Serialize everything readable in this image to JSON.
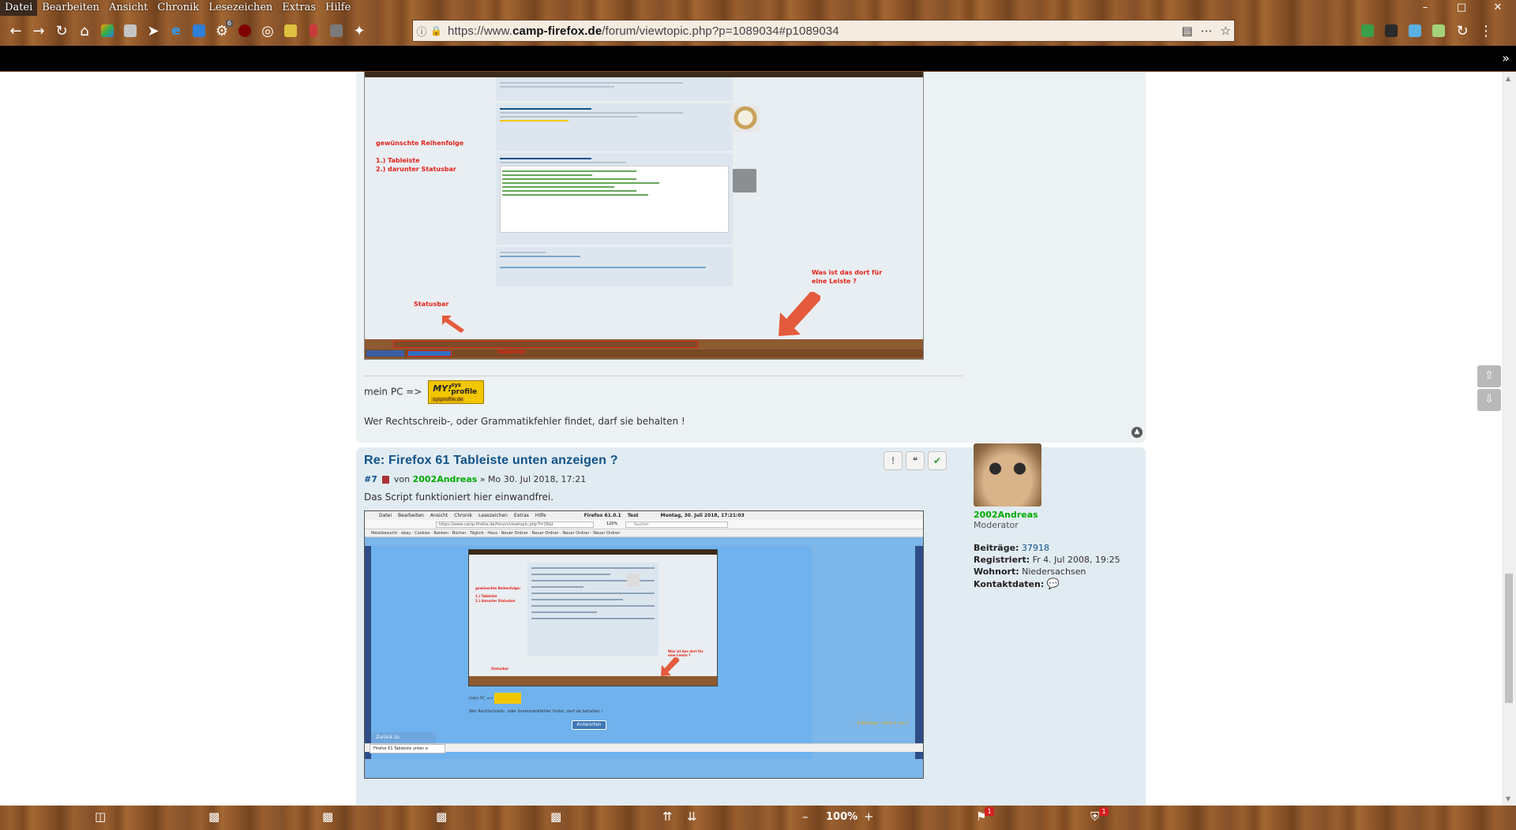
{
  "menubar": {
    "items": [
      "Datei",
      "Bearbeiten",
      "Ansicht",
      "Chronik",
      "Lesezeichen",
      "Extras",
      "Hilfe"
    ],
    "window_controls": [
      "–",
      "□",
      "✕"
    ]
  },
  "navbar": {
    "url_prefix": "https://www.",
    "url_domain": "camp-firefox.de",
    "url_path": "/forum/viewtopic.php?p=1089034#p1089034",
    "ublock_badge": "6"
  },
  "post1": {
    "screenshot_labels": {
      "wish_title": "gewünschte Reihenfolge",
      "wish_line1": "1.) Tableiste",
      "wish_line2": "2.) darunter Statusbar",
      "question": "Was ist das dort für eine Leiste ?",
      "statusbar": "Statusbar",
      "tableiste": "Tableiste"
    },
    "sig_prefix": "mein PC =>",
    "sig_logo_my": "MY!",
    "sig_logo_sys": "sys",
    "sig_logo_profile": "profile",
    "sig_logo_url": "sysprofile.de",
    "sig_line": "Wer Rechtschreib-, oder Grammatikfehler findet, darf sie behalten !"
  },
  "post2": {
    "title": "Re: Firefox 61 Tableiste unten anzeigen ?",
    "number": "#7",
    "by": "von",
    "author": "2002Andreas",
    "date": "» Mo 30. Jul 2018, 17:21",
    "body": "Das Script funktioniert hier einwandfrei.",
    "actions": [
      "!",
      "❝",
      "✔"
    ],
    "screenshot": {
      "menu": [
        "Datei",
        "Bearbeiten",
        "Ansicht",
        "Chronik",
        "Lesezeichen",
        "Extras",
        "Hilfe",
        "Firefox 61.0.1",
        "Test",
        "Montag, 30. Juli 2018, 17:21:03"
      ],
      "url": "https://www.camp-firefox.de/forum/viewtopic.php?f=16&t",
      "zoom": "120%",
      "search": "Suchen",
      "bookmarks": "Meistbesucht · ebay · Cookies · Banken · Bücher · Täglich · Haus · Neuer Ordner · Neuer Ordner · Neuer Ordner · Neuer Ordner",
      "sig": "mein PC =>",
      "sig_line": "Wer Rechtschreib-, oder Grammatikfehler findet, darf sie behalten !",
      "reply": "Antworten",
      "pagecount": "6 Beiträge • Seite 1 von 1",
      "back": "Zurück zu „Anpassungen\"",
      "tab": "Firefox 61 Tableiste unten a",
      "wish_title": "gewünschte Reihenfolge:",
      "wish_line1": "1.) Tableiste",
      "wish_line2": "2.) darunter Statusbar",
      "question": "Was ist das dort für eine Leiste ?",
      "statusbar": "Statusbar"
    }
  },
  "profile": {
    "name": "2002Andreas",
    "rank": "Moderator",
    "posts_label": "Beiträge:",
    "posts": "37918",
    "registered_label": "Registriert:",
    "registered": "Fr 4. Jul 2008, 19:25",
    "location_label": "Wohnort:",
    "location": "Niedersachsen",
    "contact_label": "Kontaktdaten:"
  },
  "statusbar": {
    "zoom": "100%",
    "minus": "–",
    "plus": "+",
    "badge1": "1",
    "badge2": "1"
  },
  "colors": {
    "link": "#105289",
    "username": "#00aa00",
    "annotation_red": "#e2231a",
    "post_bg": "#e1ebf2"
  }
}
